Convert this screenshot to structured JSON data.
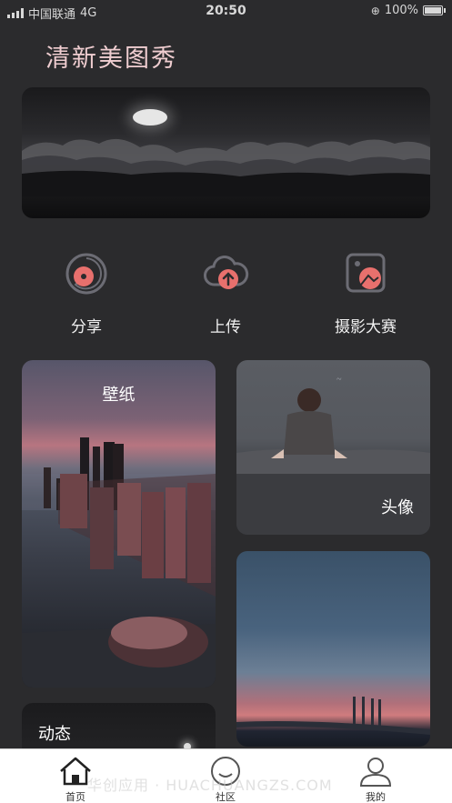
{
  "status_bar": {
    "carrier": "中国联通",
    "network": "4G",
    "time": "20:50",
    "battery": "100%"
  },
  "app": {
    "title": "清新美图秀"
  },
  "quick_actions": [
    {
      "label": "分享",
      "icon": "share-disc-icon"
    },
    {
      "label": "上传",
      "icon": "cloud-upload-icon"
    },
    {
      "label": "摄影大赛",
      "icon": "photo-contest-icon"
    }
  ],
  "cards": {
    "wallpaper": "壁纸",
    "avatar": "头像",
    "news": "动态"
  },
  "tab_bar": [
    {
      "label": "首页",
      "icon": "home-icon"
    },
    {
      "label": "社区",
      "icon": "community-icon"
    },
    {
      "label": "我的",
      "icon": "profile-icon"
    }
  ],
  "watermark": "华创应用 · HUACHUANGZS.COM",
  "colors": {
    "background": "#2b2b2d",
    "accent": "#e8706d",
    "title": "#efcdd0",
    "tab_bar": "#ffffff"
  }
}
